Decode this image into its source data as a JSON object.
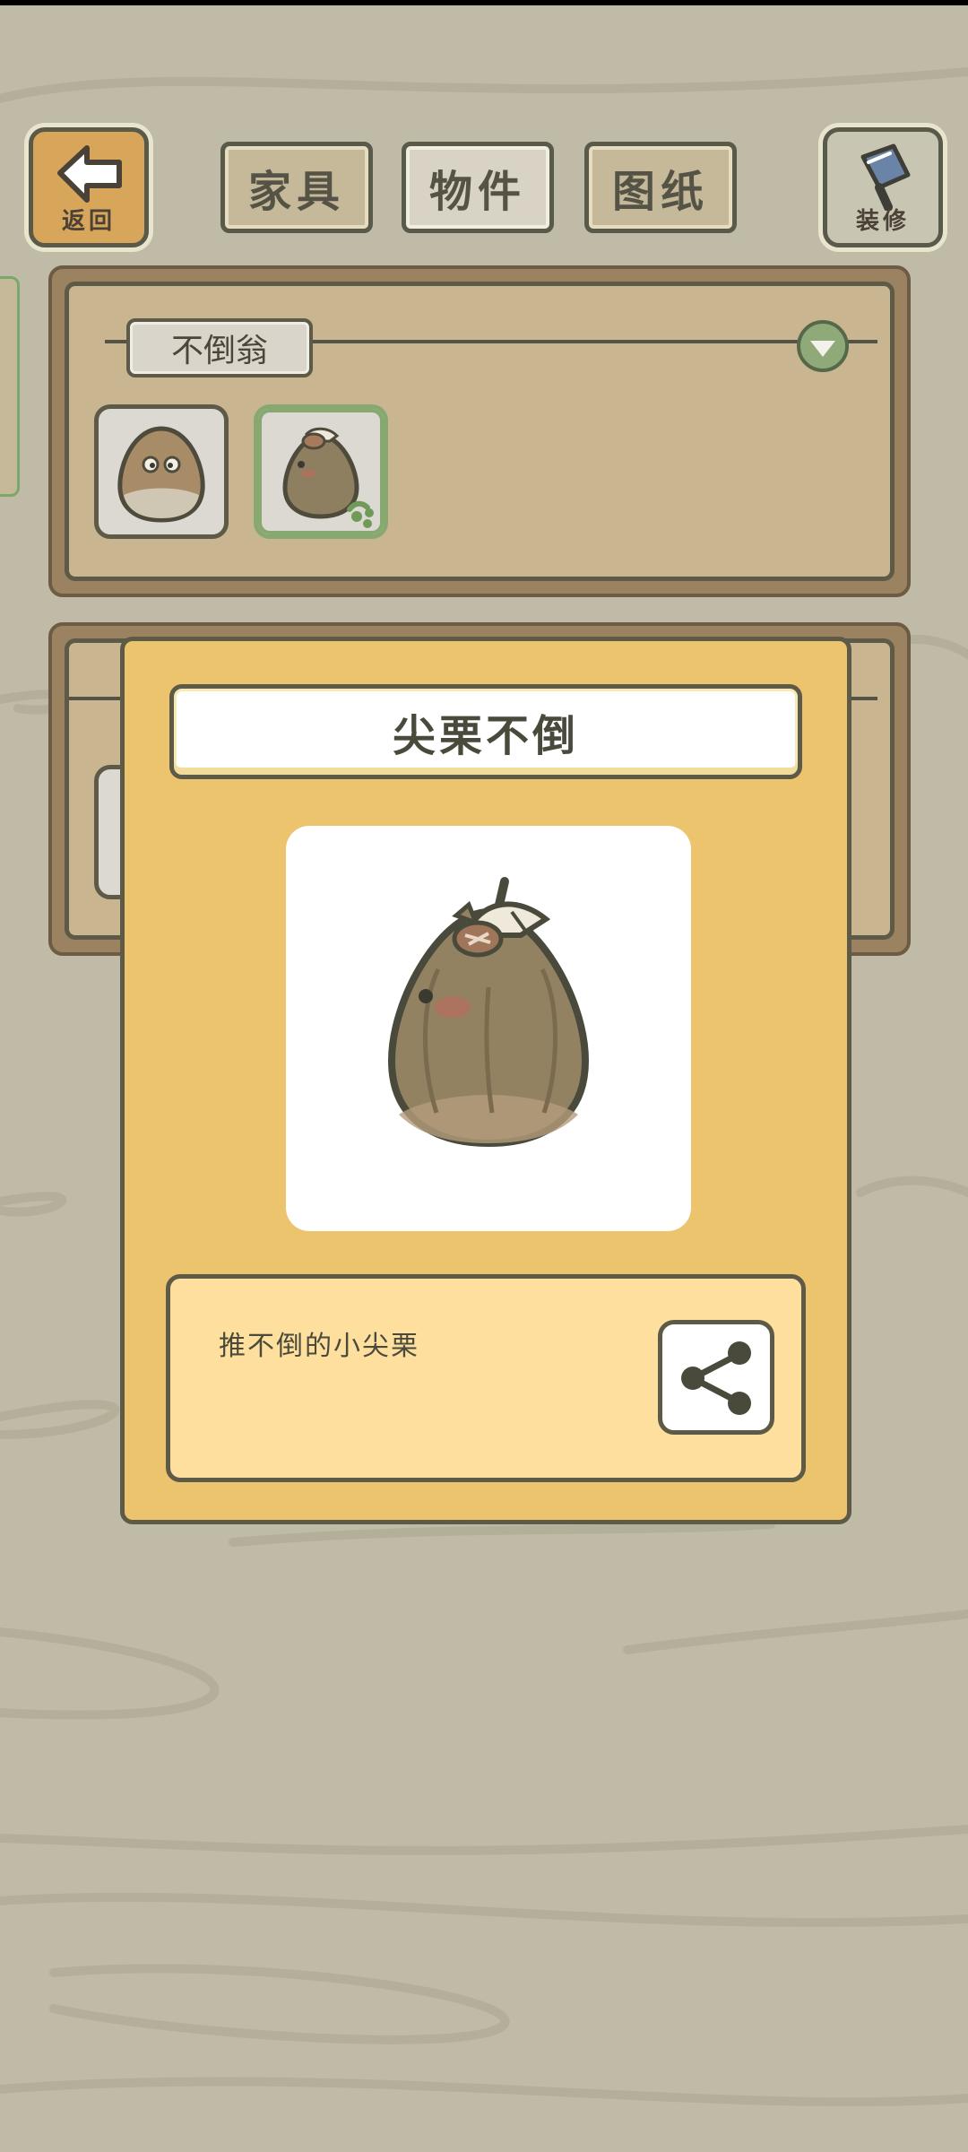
{
  "top_bar": {
    "back_label": "返回",
    "decorate_label": "装修",
    "tabs": [
      {
        "label": "家具",
        "active": false
      },
      {
        "label": "物件",
        "active": true
      },
      {
        "label": "图纸",
        "active": false
      }
    ]
  },
  "category_panel": {
    "category_label": "不倒翁",
    "items": [
      {
        "icon": "tumbler-egg-icon",
        "selected": false
      },
      {
        "icon": "chestnut-tumbler-icon",
        "selected": true
      }
    ]
  },
  "detail_modal": {
    "title": "尖栗不倒",
    "image_icon": "chestnut-tumbler-icon",
    "description": "推不倒的小尖栗",
    "share_icon": "share-icon"
  },
  "colors": {
    "background": "#bfbba6",
    "modal": "#ecc46e",
    "description_box": "#fedf9e",
    "selected_border": "#87a870",
    "panel_inner": "#c9b590"
  }
}
